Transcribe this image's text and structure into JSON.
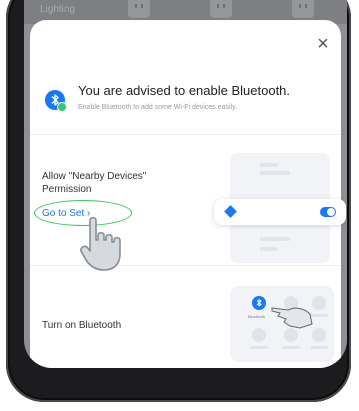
{
  "background": {
    "row_label": "Lighting"
  },
  "sheet": {
    "close_glyph": "×",
    "title": "You are advised to enable Bluetooth.",
    "subtitle": "Enable Bluetooth to add some Wi-Fi devices easily.",
    "permission_label": "Allow \"Nearby Devices\" Permission",
    "go_to_set_label": "Go to Set ›",
    "turn_on_label": "Turn on Bluetooth",
    "illustration_caption": "Bluetooth"
  },
  "icons": {
    "bluetooth": "bluetooth-icon",
    "close": "close-icon",
    "hand": "pointing-hand-icon"
  },
  "colors": {
    "accent": "#1677ff",
    "highlight_ring": "#34c759",
    "status_dot": "#2ecc71"
  }
}
